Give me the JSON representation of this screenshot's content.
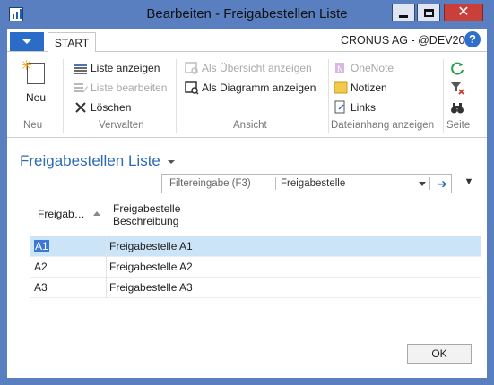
{
  "window": {
    "title": "Bearbeiten - Freigabestellen Liste"
  },
  "ribbon": {
    "tab_start": "START",
    "company": "CRONUS AG - @DEV20…",
    "help": "?",
    "new_label": "Neu",
    "groups": {
      "neu": "Neu",
      "verwalten": "Verwalten",
      "ansicht": "Ansicht",
      "dateianhang": "Dateianhang anzeigen",
      "seite": "Seite"
    },
    "commands": {
      "liste_anzeigen": "Liste anzeigen",
      "liste_bearbeiten": "Liste bearbeiten",
      "loeschen": "Löschen",
      "als_uebersicht": "Als Übersicht anzeigen",
      "als_diagramm": "Als Diagramm anzeigen",
      "onenote": "OneNote",
      "notizen": "Notizen",
      "links": "Links"
    }
  },
  "page": {
    "title": "Freigabestellen Liste",
    "filter_hint": "Filtereingabe (F3)",
    "filter_field": "Freigabestelle"
  },
  "grid": {
    "col1_header": "Freigab…",
    "col2_header_line1": "Freigabestelle",
    "col2_header_line2": "Beschreibung",
    "rows": [
      {
        "code": "A1",
        "desc": "Freigabestelle A1"
      },
      {
        "code": "A2",
        "desc": "Freigabestelle A2"
      },
      {
        "code": "A3",
        "desc": "Freigabestelle A3"
      }
    ]
  },
  "footer": {
    "ok_label": "OK"
  },
  "colors": {
    "accent": "#2b6cc8",
    "titlebar": "#5a7fc0",
    "title_text": "#2d6bb5",
    "selection": "#cce4f7"
  }
}
